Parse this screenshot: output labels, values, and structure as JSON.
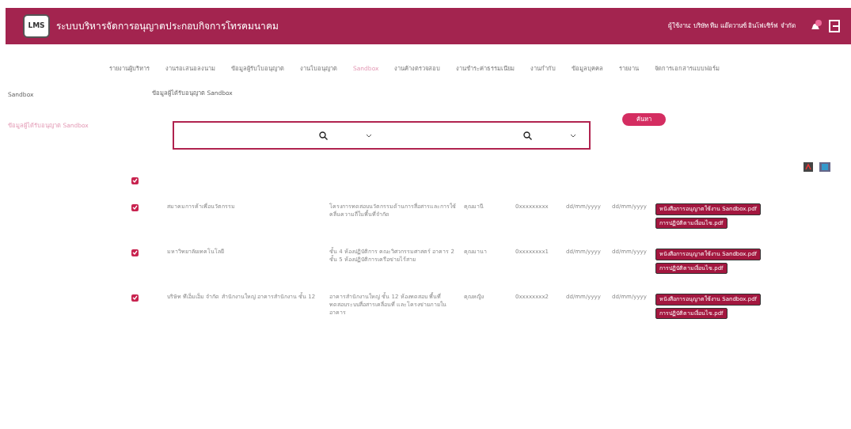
{
  "header": {
    "logo": "LMS",
    "title": "ระบบบริหารจัดการอนุญาตประกอบกิจการโทรคมนาคม",
    "user": "ผู้ใช้งาน: บริษัท ทีม แอ๊ดวานซ์ อินโฟเซิร์ฟ จำกัด",
    "has_notification": true
  },
  "nav": [
    {
      "label": "รายงานผู้บริหาร",
      "selected": false
    },
    {
      "label": "งานรอเสนอลงนาม",
      "selected": false
    },
    {
      "label": "ข้อมูลผู้รับใบอนุญาต",
      "selected": false
    },
    {
      "label": "งานใบอนุญาต",
      "selected": false
    },
    {
      "label": "Sandbox",
      "selected": true
    },
    {
      "label": "งานค้างตรวจสอบ",
      "selected": false
    },
    {
      "label": "งานชำระค่าธรรมเนียม",
      "selected": false
    },
    {
      "label": "งานกำกับ",
      "selected": false
    },
    {
      "label": "ข้อมูลบุคคล",
      "selected": false
    },
    {
      "label": "รายงาน",
      "selected": false
    },
    {
      "label": "จัดการเอกสารแบบฟอร์ม",
      "selected": false
    }
  ],
  "sidebar": {
    "title": "Sandbox",
    "items": [
      {
        "label": "ข้อมูลผู้ได้รับอนุญาต Sandbox",
        "selected": true
      }
    ]
  },
  "page_title": "ข้อมูลผู้ได้รับอนุญาต Sandbox",
  "search": {
    "fields": [
      {
        "kind": "select"
      },
      {
        "kind": "select"
      }
    ],
    "button": "ค้นหา"
  },
  "table": {
    "all_checked": true,
    "rows": [
      {
        "checked": true,
        "name": "สมาคมการค้าเพื่อนวัตกรรม",
        "description": "โครงการทดสอบนวัตกรรมด้านการสื่อสารและการใช้คลื่นความถี่ในพื้นที่จำกัด",
        "contact": "คุณมานี",
        "phone": "0xxxxxxxxx",
        "start": "dd/mm/yyyy",
        "end": "dd/mm/yyyy",
        "files": [
          "หนังสือการอนุญาตใช้งาน Sandbox.pdf",
          "การปฏิบัติตามเงื่อนไข.pdf"
        ]
      },
      {
        "checked": true,
        "name": "มหาวิทยาลัยเทคโนโลยี",
        "description": "ชั้น 4 ห้องปฏิบัติการ คณะวิศวกรรมศาสตร์ อาคาร 2 ชั้น 5 ห้องปฏิบัติการเครือข่ายไร้สาย",
        "contact": "คุณมานา",
        "phone": "0xxxxxxxx1",
        "start": "dd/mm/yyyy",
        "end": "dd/mm/yyyy",
        "files": [
          "หนังสือการอนุญาตใช้งาน Sandbox.pdf",
          "การปฏิบัติตามเงื่อนไข.pdf"
        ]
      },
      {
        "checked": true,
        "name": "บริษัท ทีเอ็มเอ็ม จำกัด สำนักงานใหญ่ อาคารสำนักงาน ชั้น 12",
        "description": "อาคารสำนักงานใหญ่ ชั้น 12 ห้องทดสอบ พื้นที่ทดสอบระบบสื่อสารเคลื่อนที่ และโครงข่ายภายในอาคาร",
        "contact": "คุณหญิง",
        "phone": "0xxxxxxxx2",
        "start": "dd/mm/yyyy",
        "end": "dd/mm/yyyy",
        "files": [
          "หนังสือการอนุญาตใช้งาน Sandbox.pdf",
          "การปฏิบัติตามเงื่อนไข.pdf"
        ]
      }
    ]
  }
}
